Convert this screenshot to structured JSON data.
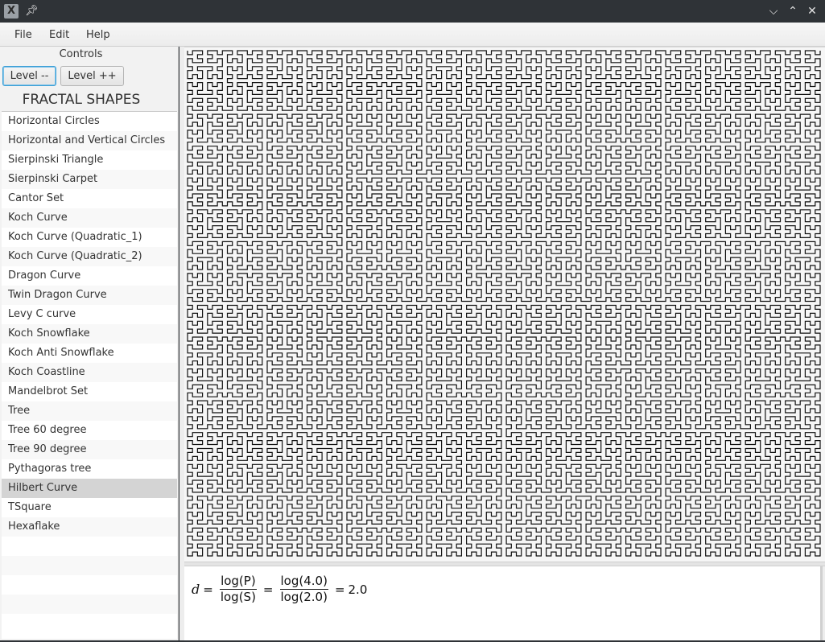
{
  "window": {
    "app_icon": "x-app-icon",
    "pin_icon": "pin-icon",
    "controls": {
      "minimize": "chevron-down-icon",
      "maximize": "chevron-up-icon",
      "close": "close-icon"
    }
  },
  "menu": {
    "items": [
      {
        "label": "File"
      },
      {
        "label": "Edit"
      },
      {
        "label": "Help"
      }
    ]
  },
  "controls": {
    "label": "Controls",
    "level_down_label": "Level --",
    "level_up_label": "Level ++"
  },
  "shapes": {
    "title": "FRACTAL SHAPES",
    "selected": "Hilbert Curve",
    "items": [
      "Horizontal Circles",
      "Horizontal and Vertical Circles",
      "Sierpinski Triangle",
      "Sierpinski Carpet",
      "Cantor Set",
      "Koch Curve",
      "Koch Curve (Quadratic_1)",
      "Koch Curve (Quadratic_2)",
      "Dragon Curve",
      "Twin Dragon Curve",
      "Levy C curve",
      "Koch Snowflake",
      "Koch Anti Snowflake",
      "Koch Coastline",
      "Mandelbrot Set",
      "Tree",
      "Tree 60 degree",
      "Tree 90 degree",
      "Pythagoras tree",
      "Hilbert Curve",
      "TSquare",
      "Hexaflake"
    ],
    "empty_rows": 5
  },
  "canvas": {
    "fractal": "Hilbert Curve",
    "level": 7,
    "stroke_color": "#111111",
    "background": "#f6f6f6"
  },
  "formula": {
    "lhs": "d",
    "eq1": "=",
    "num_symbolic": "log(P)",
    "den_symbolic": "log(S)",
    "eq2": "=",
    "num_value": "log(4.0)",
    "den_value": "log(2.0)",
    "eq3": "=",
    "result": "2.0"
  }
}
